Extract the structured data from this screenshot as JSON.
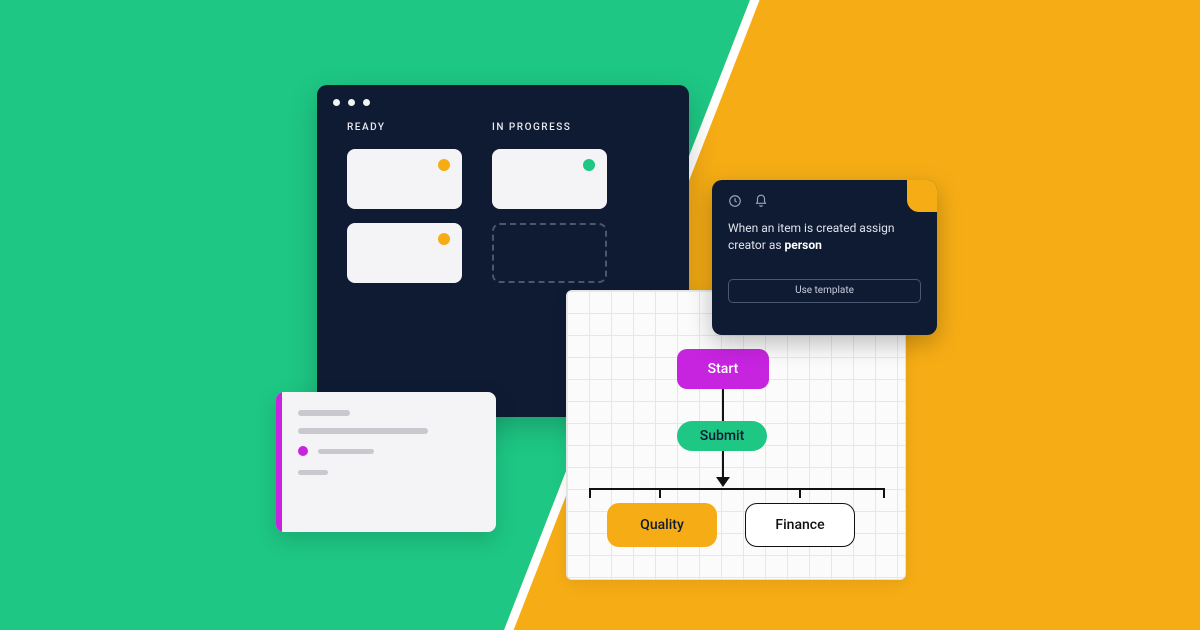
{
  "kanban": {
    "columns": [
      {
        "title": "READY",
        "cards": [
          {
            "dot": "amber"
          },
          {
            "dot": "amber"
          }
        ]
      },
      {
        "title": "IN PROGRESS",
        "cards": [
          {
            "dot": "green"
          },
          {
            "placeholder": true
          }
        ]
      }
    ]
  },
  "flow": {
    "start": "Start",
    "submit": "Submit",
    "quality": "Quality",
    "finance": "Finance"
  },
  "automation": {
    "rule_prefix": "When an item is created assign creator as ",
    "rule_bold": "person",
    "button": "Use template"
  },
  "icons": {
    "clock": "clock-icon",
    "bell": "bell-icon"
  }
}
